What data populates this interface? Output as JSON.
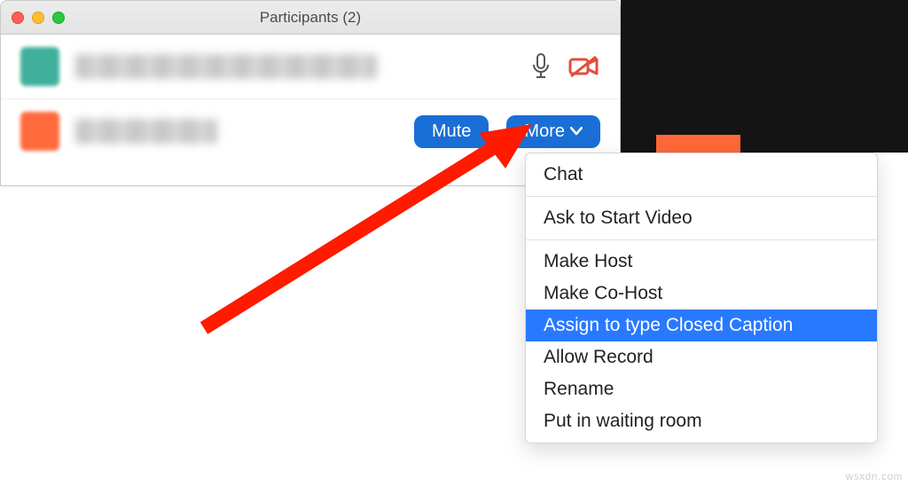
{
  "window": {
    "title": "Participants (2)",
    "colors": {
      "accent": "#1a6fd6",
      "highlight": "#2979ff",
      "danger": "#e44c3b"
    }
  },
  "participants": [
    {
      "name": "(blurred)",
      "avatar_color": "teal",
      "icons": [
        "mic-icon",
        "camera-off-icon"
      ],
      "mic_muted": false,
      "camera_off": true
    },
    {
      "name": "(blurred)",
      "avatar_color": "orange",
      "buttons": {
        "mute": "Mute",
        "more": "More"
      }
    }
  ],
  "menu": {
    "items": [
      "Chat",
      "Ask to Start Video",
      "Make Host",
      "Make Co-Host",
      "Assign to type Closed Caption",
      "Allow Record",
      "Rename",
      "Put in waiting room"
    ],
    "highlighted_index": 4,
    "separators_after": [
      0,
      1
    ]
  },
  "watermark": "wsxdn.com"
}
